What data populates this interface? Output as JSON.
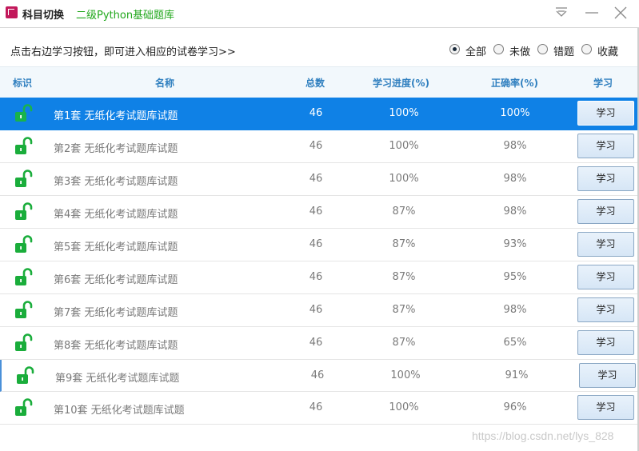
{
  "window": {
    "title": "科目切换",
    "subject": "二级Python基础题库"
  },
  "hint": "点击右边学习按钮，即可进入相应的试卷学习>>",
  "filters": [
    {
      "label": "全部",
      "selected": true
    },
    {
      "label": "未做",
      "selected": false
    },
    {
      "label": "错题",
      "selected": false
    },
    {
      "label": "收藏",
      "selected": false
    }
  ],
  "columns": {
    "flag": "标识",
    "name": "名称",
    "total": "总数",
    "progress": "学习进度(%)",
    "accuracy": "正确率(%)",
    "study": "学习"
  },
  "rows": [
    {
      "name": "第1套 无纸化考试题库试题",
      "total": "46",
      "progress": "100%",
      "accuracy": "100%",
      "button": "学习"
    },
    {
      "name": "第2套 无纸化考试题库试题",
      "total": "46",
      "progress": "100%",
      "accuracy": "98%",
      "button": "学习"
    },
    {
      "name": "第3套 无纸化考试题库试题",
      "total": "46",
      "progress": "100%",
      "accuracy": "98%",
      "button": "学习"
    },
    {
      "name": "第4套 无纸化考试题库试题",
      "total": "46",
      "progress": "87%",
      "accuracy": "98%",
      "button": "学习"
    },
    {
      "name": "第5套 无纸化考试题库试题",
      "total": "46",
      "progress": "87%",
      "accuracy": "93%",
      "button": "学习"
    },
    {
      "name": "第6套 无纸化考试题库试题",
      "total": "46",
      "progress": "87%",
      "accuracy": "95%",
      "button": "学习"
    },
    {
      "name": "第7套 无纸化考试题库试题",
      "total": "46",
      "progress": "87%",
      "accuracy": "98%",
      "button": "学习"
    },
    {
      "name": "第8套 无纸化考试题库试题",
      "total": "46",
      "progress": "87%",
      "accuracy": "65%",
      "button": "学习"
    },
    {
      "name": "第9套 无纸化考试题库试题",
      "total": "46",
      "progress": "100%",
      "accuracy": "91%",
      "button": "学习"
    },
    {
      "name": "第10套 无纸化考试题库试题",
      "total": "46",
      "progress": "100%",
      "accuracy": "96%",
      "button": "学习"
    }
  ],
  "icons": {
    "row_flag": "unlocked-lock-icon",
    "menu": "dropdown-menu-icon",
    "minimize": "minimize-icon",
    "close": "close-icon"
  },
  "colors": {
    "selected_row": "#0f81e6",
    "lock_green": "#1aad3b",
    "subject_green": "#20a71b",
    "header_text": "#2f7fbf"
  },
  "watermark": "https://blog.csdn.net/lys_828"
}
